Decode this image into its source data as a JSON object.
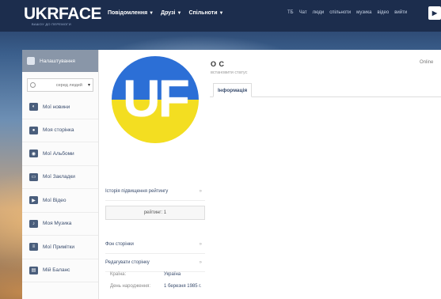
{
  "header": {
    "logo": "UKRFACE",
    "logo_sub": "ВАШОУ ДО ПЕРЕМОГИ",
    "nav": [
      {
        "label": "Повідомлення"
      },
      {
        "label": "Друзі"
      },
      {
        "label": "Спільноти"
      }
    ],
    "nav_right": [
      "ТБ",
      "Чат",
      "люди",
      "спільноти",
      "музика",
      "відео",
      "вийти"
    ]
  },
  "sidebar": {
    "settings_label": "Налаштування",
    "search_placeholder": "серед людей",
    "items": [
      {
        "label": "Мої новини",
        "icon": "news-icon"
      },
      {
        "label": "Моя сторінка",
        "icon": "user-icon"
      },
      {
        "label": "Мої Альбоми",
        "icon": "camera-icon"
      },
      {
        "label": "Мої Закладки",
        "icon": "bookmark-icon"
      },
      {
        "label": "Мої Відео",
        "icon": "video-icon"
      },
      {
        "label": "Моя Музика",
        "icon": "music-icon"
      },
      {
        "label": "Мої Примітки",
        "icon": "notes-icon"
      },
      {
        "label": "Мій Баланс",
        "icon": "balance-icon"
      }
    ]
  },
  "profile": {
    "avatar_text": "UF",
    "name": "O C",
    "status_placeholder": "встановити статус",
    "online": "Online",
    "tab_info": "Інформація",
    "rating_history": "Історія підвищення рейтингу",
    "rating": "рейтинг: 1",
    "page_bg": "Фон сторінки",
    "edit_page": "Редагувати сторінку",
    "country_label": "Країна:",
    "country_value": "Україна",
    "birthday_label": "День народження:",
    "birthday_value": "1 березня 1985 г."
  },
  "colors": {
    "header_bg": "#1c2d4d",
    "avatar_blue": "#2c6fd6",
    "avatar_yellow": "#f3de21",
    "settings_bg": "#8996a8"
  }
}
